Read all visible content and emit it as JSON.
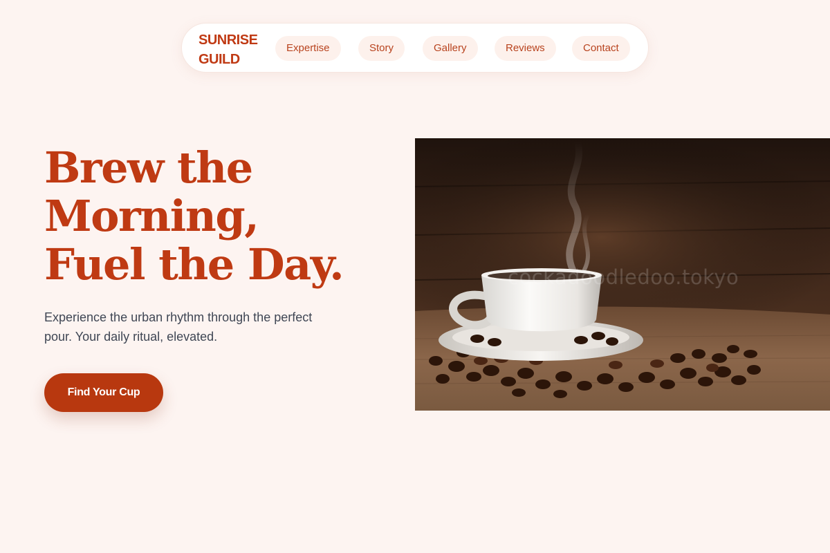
{
  "nav": {
    "brand": "SUNRISE GUILD",
    "links": [
      "Expertise",
      "Story",
      "Gallery",
      "Reviews",
      "Contact"
    ]
  },
  "hero": {
    "headline": [
      "Brew the",
      "Morning,",
      "Fuel the Day."
    ],
    "subtext": "Experience the urban rhythm through the perfect pour. Your daily ritual, elevated.",
    "cta_label": "Find Your Cup",
    "image": {
      "subject": "steaming white coffee cup on saucer with coffee beans on burlap",
      "watermark": "cockadoodledoo.tokyo"
    }
  },
  "colors": {
    "background": "#fdf4f1",
    "accent": "#bf3a13",
    "nav_pill": "#fdf1ec",
    "body_text": "#3f4654"
  }
}
